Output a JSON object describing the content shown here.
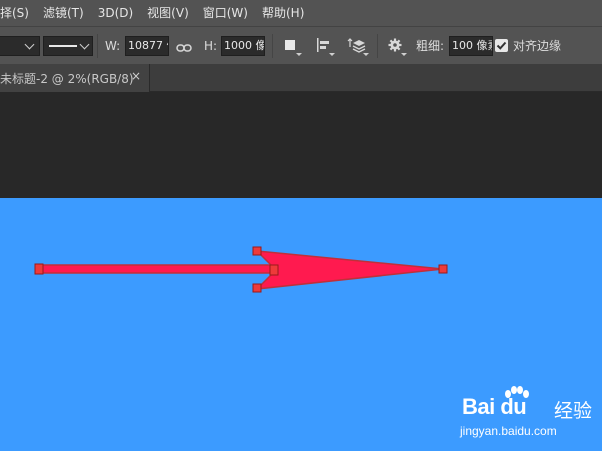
{
  "menu": {
    "items": [
      {
        "label": "择(S)"
      },
      {
        "label": "滤镜(T)"
      },
      {
        "label": "3D(D)"
      },
      {
        "label": "视图(V)"
      },
      {
        "label": "窗口(W)"
      },
      {
        "label": "帮助(H)"
      }
    ]
  },
  "options": {
    "w_label": "W:",
    "w_value": "10877 像",
    "h_label": "H:",
    "h_value": "1000 像",
    "weight_label": "粗细:",
    "weight_value": "100 像素",
    "align_edges_label": "对齐边缘",
    "align_edges_checked": true
  },
  "tab": {
    "title": "未标题-2 @ 2%(RGB/8)",
    "close": "×"
  },
  "canvas": {
    "background_color": "#3c9bff",
    "arrow_fill": "#ff1a4f",
    "arrow_stroke": "#c0303a",
    "anchor_color": "#ee3a3a"
  },
  "watermark": {
    "brand": "Bai du",
    "service": "经验",
    "url": "jingyan.baidu.com"
  },
  "icons": [
    "link-icon",
    "fill-square-icon",
    "align-icon",
    "arrange-icon",
    "gear-icon",
    "checkbox-icon",
    "close-icon",
    "baidu-paw-icon"
  ]
}
